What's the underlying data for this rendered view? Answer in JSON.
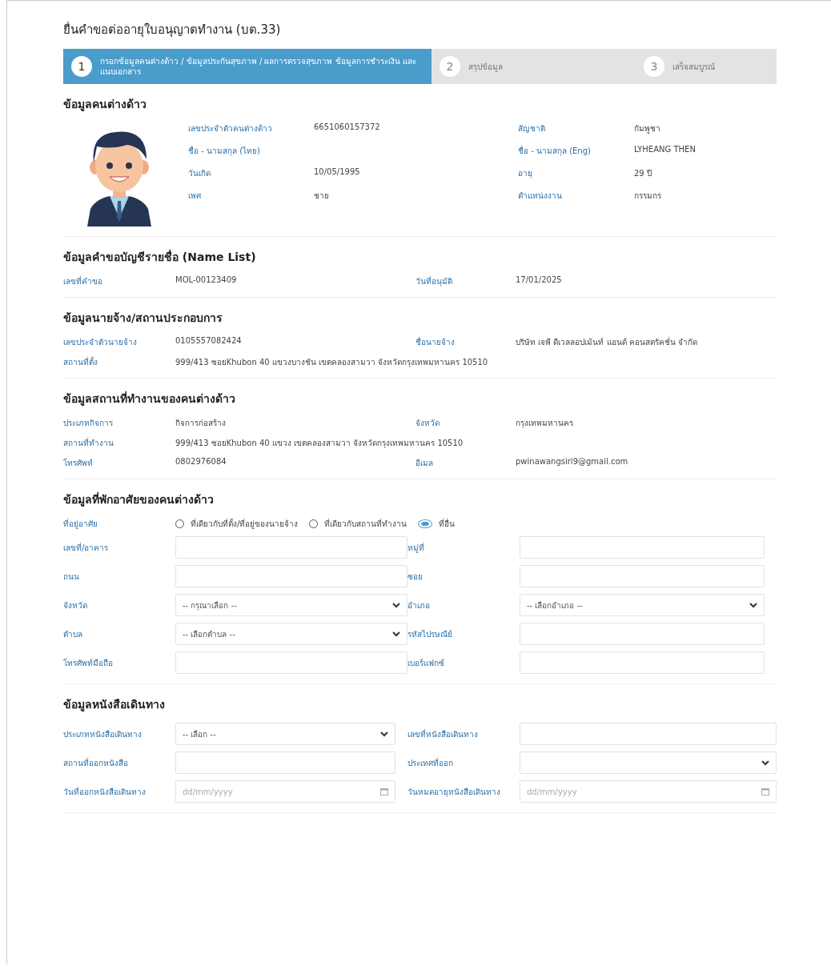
{
  "page_title": "ยื่นคำขอต่ออายุใบอนุญาตทำงาน (บต.33)",
  "steps": [
    {
      "number": "1",
      "label": "กรอกข้อมูลคนต่างด้าว / ข้อมูลประกันสุขภาพ / ผลการตรวจสุขภาพ ข้อมูลการชำระเงิน และแนบเอกสาร",
      "selected": true
    },
    {
      "number": "2",
      "label": "สรุปข้อมูล",
      "selected": false
    },
    {
      "number": "3",
      "label": "เสร็จสมบูรณ์",
      "selected": false
    }
  ],
  "sections": [
    {
      "kind": "person",
      "title": "ข้อมูลคนต่างด้าว",
      "rows": [
        [
          {
            "label": "เลขประจำตัวคนต่างด้าว",
            "value": "6651060157372"
          },
          {
            "label": "สัญชาติ",
            "value": "กัมพูชา"
          }
        ],
        [
          {
            "label": "ชื่อ - นามสกุล (ไทย)"
          },
          {
            "label": "ชื่อ - นามสกุล (Eng)",
            "value": "LYHEANG THEN"
          }
        ],
        [
          {
            "label": "วันเกิด",
            "value": "10/05/1995"
          },
          {
            "label": "อายุ",
            "value": "29 ปี"
          }
        ],
        [
          {
            "label": "เพศ",
            "value": "ชาย"
          },
          {
            "label": "ตำแหน่งงาน",
            "value": "กรรมกร"
          }
        ]
      ]
    },
    {
      "kind": "details",
      "title": "ข้อมูลคำขอบัญชีรายชื่อ (Name List)",
      "rows": [
        [
          {
            "label": "เลขที่คำขอ",
            "value": "MOL-00123409"
          },
          {
            "label": "วันที่อนุมัติ",
            "value": "17/01/2025"
          }
        ]
      ]
    },
    {
      "kind": "details",
      "title": "ข้อมูลนายจ้าง/สถานประกอบการ",
      "rows": [
        [
          {
            "label": "เลขประจำตัวนายจ้าง",
            "value": "0105557082424"
          },
          {
            "label": "ชื่อนายจ้าง",
            "value": "บริษัท เจพี ดีเวลลอปเม้นท์ แอนด์ คอนสตรัคชั่น จำกัด"
          }
        ],
        [
          {
            "label": "สถานที่ตั้ง",
            "value": "999/413 ซอยKhubon 40 แขวงบางชัน เขตคลองสามวา จังหวัดกรุงเทพมหานคร 10510"
          }
        ]
      ]
    },
    {
      "kind": "details",
      "title": "ข้อมูลสถานที่ทำงานของคนต่างด้าว",
      "rows": [
        [
          {
            "label": "ประเภทกิจการ",
            "value": "กิจการก่อสร้าง"
          },
          {
            "label": "จังหวัด",
            "value": "กรุงเทพมหานคร"
          }
        ],
        [
          {
            "label": "สถานที่ทำงาน",
            "value": "999/413 ซอยKhubon 40 แขวง เขตคลองสามวา จังหวัดกรุงเทพมหานคร 10510"
          }
        ],
        [
          {
            "label": "โทรศัพท์",
            "value": "0802976084"
          },
          {
            "label": "อีเมล",
            "value": "pwinawangsiri9@gmail.com"
          }
        ]
      ]
    },
    {
      "kind": "form",
      "title": "ข้อมูลที่พักอาศัยของคนต่างด้าว",
      "rows": [
        [
          {
            "kind": "radio",
            "label": "ที่อยู่อาศัย",
            "options": [
              {
                "label": "ที่เดียวกับที่ตั้ง/ที่อยู่ของนายจ้าง",
                "selected": false
              },
              {
                "label": "ที่เดียวกับสถานที่ทำงาน",
                "selected": false
              },
              {
                "label": "ที่อื่น",
                "selected": true
              }
            ]
          }
        ],
        [
          {
            "kind": "text",
            "label": "เลขที่/อาคาร"
          },
          {
            "kind": "text",
            "label": "หมู่ที่"
          }
        ],
        [
          {
            "kind": "text",
            "label": "ถนน"
          },
          {
            "kind": "text",
            "label": "ซอย"
          }
        ],
        [
          {
            "kind": "select",
            "label": "จังหวัด",
            "value": "-- กรุณาเลือก --"
          },
          {
            "kind": "select",
            "label": "อำเภอ",
            "value": "-- เลือกอำเภอ --"
          }
        ],
        [
          {
            "kind": "select",
            "label": "ตำบล",
            "value": "-- เลือกตำบล --"
          },
          {
            "kind": "text",
            "label": "รหัสไปรษณีย์"
          }
        ],
        [
          {
            "kind": "text",
            "label": "โทรศัพท์มือถือ"
          },
          {
            "kind": "text",
            "label": "เบอร์แฟกซ์"
          }
        ]
      ]
    },
    {
      "kind": "form",
      "title": "ข้อมูลหนังสือเดินทาง",
      "rows": [
        [
          {
            "kind": "select",
            "label": "ประเภทหนังสือเดินทาง",
            "value": "-- เลือก --"
          },
          {
            "kind": "text",
            "label": "เลขที่หนังสือเดินทาง"
          }
        ],
        [
          {
            "kind": "text",
            "label": "สถานที่ออกหนังสือ"
          },
          {
            "kind": "select",
            "label": "ประเทศที่ออก"
          }
        ],
        [
          {
            "kind": "date",
            "label": "วันที่ออกหนังสือเดินทาง",
            "placeholder": "dd/mm/yyyy"
          },
          {
            "kind": "date",
            "label": "วันหมดอายุหนังสือเดินทาง",
            "placeholder": "dd/mm/yyyy"
          }
        ]
      ]
    }
  ]
}
